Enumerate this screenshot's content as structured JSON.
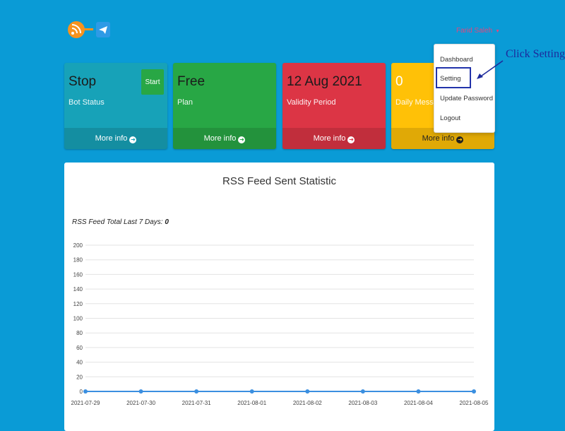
{
  "header": {
    "logo_icons": [
      "rss-icon",
      "telegram-icon"
    ],
    "user_name": "Farid Saleh",
    "caret": "▼"
  },
  "cards": [
    {
      "value": "Stop",
      "label": "Bot Status",
      "footer": "More info",
      "color": "#17a2b8"
    },
    {
      "value": "Free",
      "label": "Plan",
      "footer": "More info",
      "color": "#28a745"
    },
    {
      "value": "12 Aug 2021",
      "label": "Validity Period",
      "footer": "More info",
      "color": "#dc3545"
    },
    {
      "value": "0",
      "label": "Daily Messages",
      "footer": "More info",
      "color": "#ffc107"
    }
  ],
  "start_button": "Start",
  "dropdown": {
    "items": [
      "Dashboard",
      "Setting",
      "Update Password",
      "Logout"
    ],
    "highlighted": "Setting"
  },
  "annotation": {
    "text": "Click Setting",
    "color": "#1d2a9c"
  },
  "panel": {
    "title": "RSS Feed Sent Statistic",
    "total_label": "RSS Feed Total Last 7 Days:",
    "total_value": "0"
  },
  "chart_data": {
    "type": "line",
    "title": "",
    "xlabel": "",
    "ylabel": "",
    "x": [
      "2021-07-29",
      "2021-07-30",
      "2021-07-31",
      "2021-08-01",
      "2021-08-02",
      "2021-08-03",
      "2021-08-04",
      "2021-08-05"
    ],
    "series": [
      {
        "values": [
          0,
          0,
          0,
          0,
          0,
          0,
          0,
          0
        ],
        "color": "#3b8fe0"
      }
    ],
    "ylim": [
      0,
      200
    ],
    "yticks": [
      0,
      20,
      40,
      60,
      80,
      100,
      120,
      140,
      160,
      180,
      200
    ],
    "grid": true
  }
}
